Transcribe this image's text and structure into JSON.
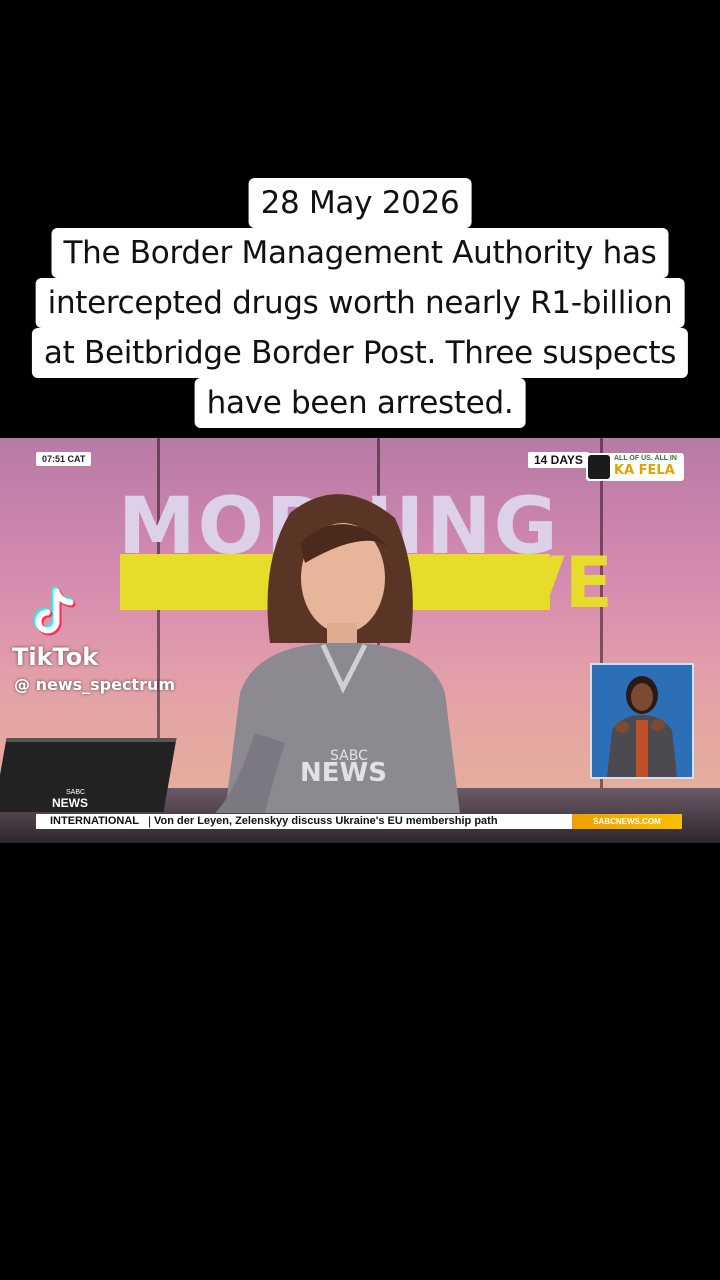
{
  "caption": {
    "lines": [
      "28 May 2026",
      "The Border Management Authority has",
      "intercepted drugs worth nearly R1-billion",
      "at Beitbridge Border Post. Three suspects",
      "have been arrested."
    ]
  },
  "broadcast": {
    "time": "07:51 CAT",
    "countdown": "14 DAYS",
    "campaign_small": "ALL OF US. ALL IN",
    "campaign_big": "KA FELA",
    "show_title": "MORNING",
    "show_live": "LIVE",
    "watermark_top": "SABC",
    "watermark_main": "NEWS",
    "channel_logo_top": "SABC",
    "channel_logo_main": "NEWS",
    "ticker_category": "INTERNATIONAL",
    "ticker_separator": "|",
    "ticker_headline": "Von der Leyen, Zelenskyy discuss Ukraine's EU membership path",
    "ticker_site": "SABCNEWS.COM"
  },
  "overlay": {
    "app_name": "TikTok",
    "handle": "@ news_spectrum"
  },
  "colors": {
    "background": "#000000",
    "show_yellow": "#e8dc2a",
    "ticker_orange": "#f0a000",
    "tiktok_cyan": "#25f4ee",
    "tiktok_red": "#fe2c55"
  }
}
